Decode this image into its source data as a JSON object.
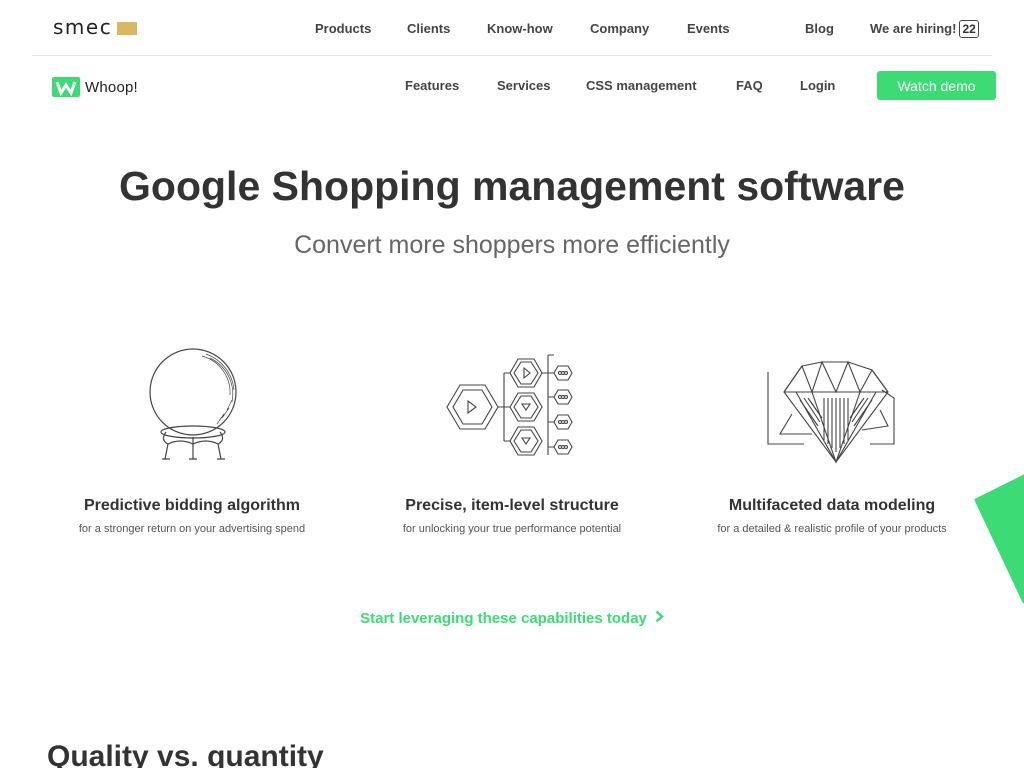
{
  "top_nav": {
    "logo_text": "smec",
    "items": [
      "Products",
      "Clients",
      "Know-how",
      "Company",
      "Events",
      "Blog"
    ],
    "hiring_label": "We are hiring!",
    "hiring_count": "22"
  },
  "product_nav": {
    "logo_text": "Whoop!",
    "items": [
      "Features",
      "Services",
      "CSS management",
      "FAQ",
      "Login"
    ],
    "demo_button": "Watch demo"
  },
  "hero": {
    "title": "Google Shopping management software",
    "subtitle": "Convert more shoppers more efficiently"
  },
  "features": [
    {
      "icon": "crystal-ball-icon",
      "title": "Predictive bidding algorithm",
      "desc": "for a stronger return on your advertising spend"
    },
    {
      "icon": "hexagon-structure-icon",
      "title": "Precise, item-level structure",
      "desc": "for unlocking your true performance potential"
    },
    {
      "icon": "diamond-icon",
      "title": "Multifaceted data modeling",
      "desc": "for a detailed & realistic profile of your products"
    }
  ],
  "cta": {
    "label": "Start leveraging these capabilities today"
  },
  "next_section": {
    "title": "Quality vs. quantity"
  },
  "colors": {
    "accent": "#3ddb76",
    "smec_gold": "#d9b862",
    "text": "#333333"
  }
}
